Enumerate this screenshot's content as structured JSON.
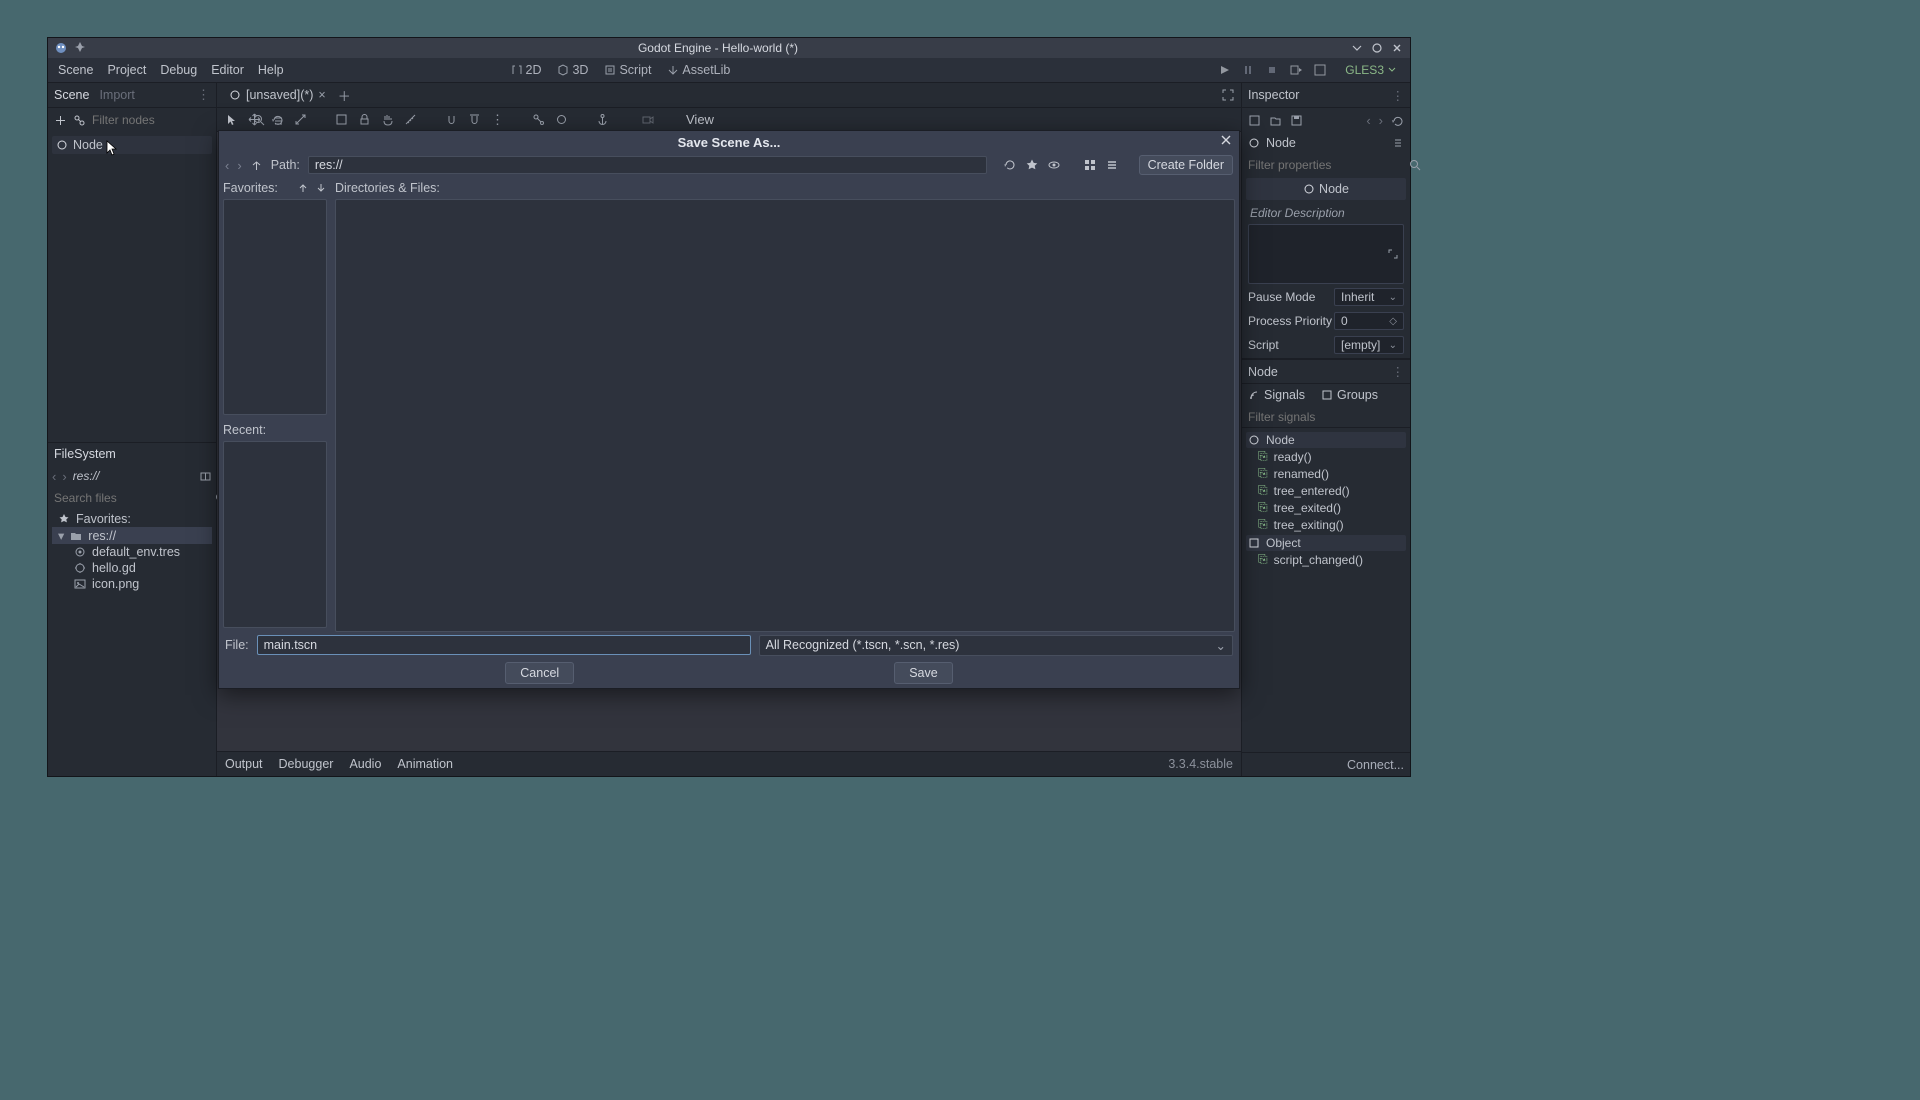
{
  "titlebar": {
    "title": "Godot Engine - Hello-world (*)"
  },
  "menus": [
    "Scene",
    "Project",
    "Debug",
    "Editor",
    "Help"
  ],
  "workspaces": {
    "_2d": "2D",
    "_3d": "3D",
    "script": "Script",
    "assetlib": "AssetLib"
  },
  "renderer": "GLES3",
  "left_dock": {
    "tab_scene": "Scene",
    "tab_import": "Import",
    "filter_placeholder": "Filter nodes",
    "root_node": "Node"
  },
  "filesystem": {
    "title": "FileSystem",
    "path": "res://",
    "search_placeholder": "Search files",
    "fav": "Favorites:",
    "root": "res://",
    "files": [
      "default_env.tres",
      "hello.gd",
      "icon.png"
    ]
  },
  "scene_tabs": {
    "unsaved": "[unsaved](*)"
  },
  "viewport": {
    "view": "View"
  },
  "bottom": {
    "output": "Output",
    "debugger": "Debugger",
    "audio": "Audio",
    "animation": "Animation",
    "version": "3.3.4.stable"
  },
  "inspector": {
    "title": "Inspector",
    "node": "Node",
    "filter_placeholder": "Filter properties",
    "section": "Node",
    "desc": "Editor Description",
    "pause_mode": "Pause Mode",
    "pause_val": "Inherit",
    "proc_prio": "Process Priority",
    "proc_val": "0",
    "script": "Script",
    "script_val": "[empty]"
  },
  "node_dock": {
    "label": "Node",
    "signals": "Signals",
    "groups": "Groups",
    "filter_placeholder": "Filter signals",
    "class_node": "Node",
    "signals_node": [
      "ready()",
      "renamed()",
      "tree_entered()",
      "tree_exited()",
      "tree_exiting()"
    ],
    "class_object": "Object",
    "signals_object": [
      "script_changed()"
    ],
    "connect": "Connect..."
  },
  "dialog": {
    "title": "Save Scene As...",
    "path_label": "Path:",
    "path": "res://",
    "fav": "Favorites:",
    "recent": "Recent:",
    "dirfiles": "Directories & Files:",
    "create_folder": "Create Folder",
    "file_label": "File:",
    "file_value": "main.tscn",
    "filter": "All Recognized (*.tscn, *.scn, *.res)",
    "cancel": "Cancel",
    "save": "Save"
  }
}
